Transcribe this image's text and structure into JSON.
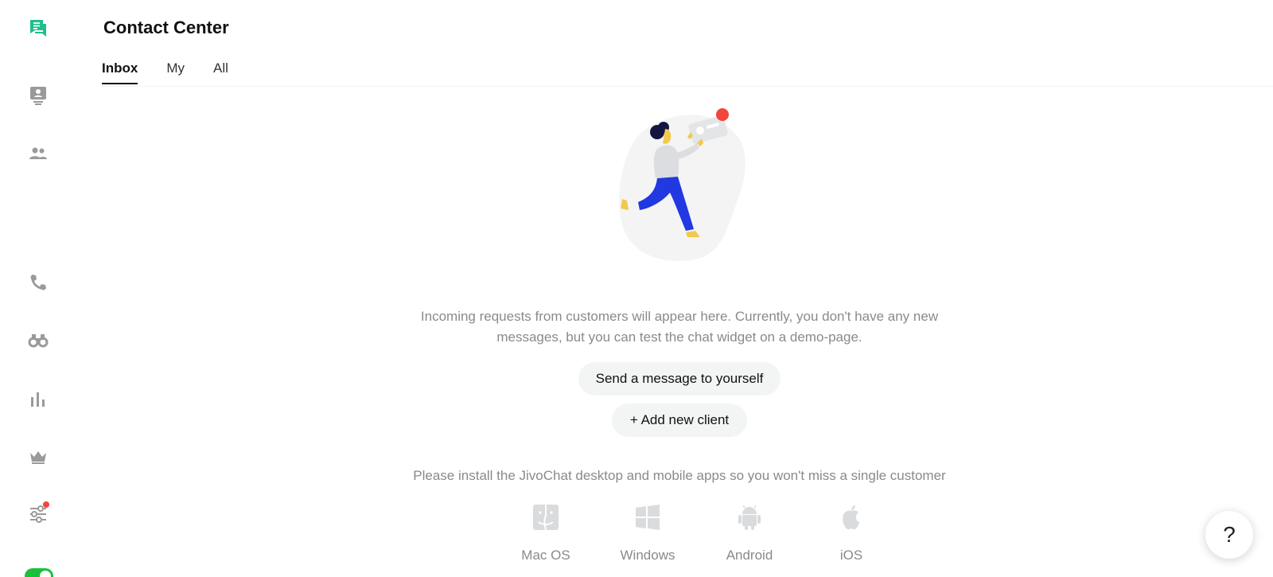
{
  "header": {
    "title": "Contact Center",
    "tabs": [
      {
        "label": "Inbox",
        "active": true
      },
      {
        "label": "My",
        "active": false
      },
      {
        "label": "All",
        "active": false
      }
    ]
  },
  "sidebar": {
    "items": [
      {
        "icon": "chat-icon",
        "active": true
      },
      {
        "icon": "contact-card-icon"
      },
      {
        "icon": "team-icon"
      },
      {
        "icon": "phone-icon"
      },
      {
        "icon": "binoculars-icon"
      },
      {
        "icon": "bar-chart-icon"
      },
      {
        "icon": "crown-icon"
      },
      {
        "icon": "settings-sliders-icon",
        "badge": true
      }
    ],
    "status_toggle": {
      "on": true
    }
  },
  "main": {
    "empty_state_text": "Incoming requests from customers will appear here. Currently, you don't have any new messages, but you can test the chat widget on a demo-page.",
    "send_message_button": "Send a message to yourself",
    "add_client_button": "+ Add new client",
    "install_text": "Please install the JivoChat desktop and mobile apps so you won't miss a single customer",
    "apps": [
      {
        "label": "Mac OS",
        "icon": "finder-icon"
      },
      {
        "label": "Windows",
        "icon": "windows-icon"
      },
      {
        "label": "Android",
        "icon": "android-icon"
      },
      {
        "label": "iOS",
        "icon": "apple-icon"
      }
    ]
  },
  "help": {
    "label": "?"
  },
  "colors": {
    "accent_green": "#18c139",
    "brand_teal": "#1fbf8f",
    "badge_red": "#f2453d",
    "muted_text": "#8a8a8a",
    "icon_gray": "#9a9a9a",
    "button_bg": "#f3f4f4"
  }
}
